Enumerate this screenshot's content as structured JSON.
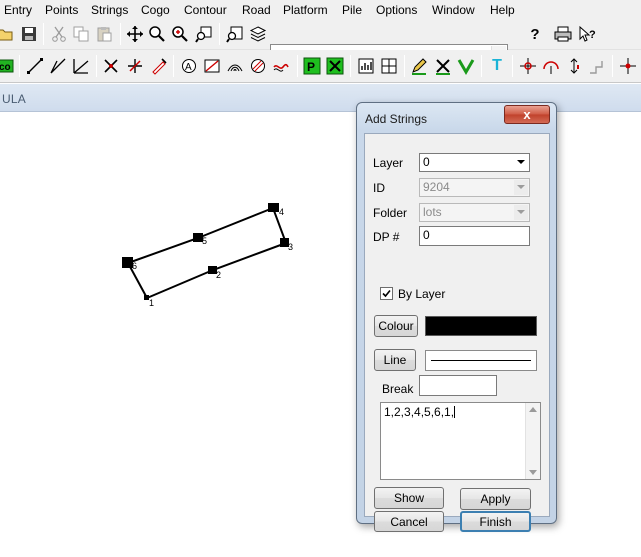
{
  "menu": [
    "Entry",
    "Points",
    "Strings",
    "Cogo",
    "Contour",
    "Road",
    "Platform",
    "Pile",
    "Options",
    "Window",
    "Help"
  ],
  "toolbar": {
    "layer_combo_value": "",
    "row1_icons": [
      "open-folder-icon",
      "save-icon",
      "cut-icon",
      "copy-icon",
      "paste-icon",
      "pan-icon",
      "zoom-in-icon",
      "zoom-window-icon",
      "zoom-previous-icon",
      "zoom-extents-icon",
      "layers-icon",
      "help-icon",
      "print-icon",
      "context-help-icon"
    ],
    "row2_icons": [
      "coordinate-icon",
      "line-icon",
      "angle-icon",
      "perpendicular-icon",
      "delete-point-icon",
      "move-point-icon",
      "edit-point-icon",
      "label-icon",
      "symbol-icon",
      "contour-icon",
      "hatch-icon",
      "fill-icon",
      "point-p-icon",
      "calc-icon",
      "check-icon",
      "table-icon",
      "grid-icon",
      "pencil-icon",
      "cross-icon",
      "v-icon",
      "text-t-icon",
      "snap-icon",
      "arc-icon",
      "offset-icon",
      "step-icon",
      "crosshair-icon"
    ]
  },
  "document": {
    "title": "ULA"
  },
  "drawing": {
    "point_labels": [
      "1",
      "2",
      "3",
      "4",
      "5",
      "6"
    ]
  },
  "dialog": {
    "title": "Add Strings",
    "close_label": "x",
    "layer_label": "Layer",
    "layer_value": "0",
    "id_label": "ID",
    "id_value": "9204",
    "folder_label": "Folder",
    "folder_value": "lots",
    "dp_label": "DP #",
    "dp_value": "0",
    "by_layer_label": "By Layer",
    "by_layer_checked": true,
    "colour_label": "Colour",
    "colour_value": "#000000",
    "line_label": "Line",
    "break_label": "Break",
    "break_value": "",
    "string_points": "1,2,3,4,5,6,1,",
    "show_label": "Show",
    "apply_label": "Apply",
    "cancel_label": "Cancel",
    "finish_label": "Finish"
  }
}
